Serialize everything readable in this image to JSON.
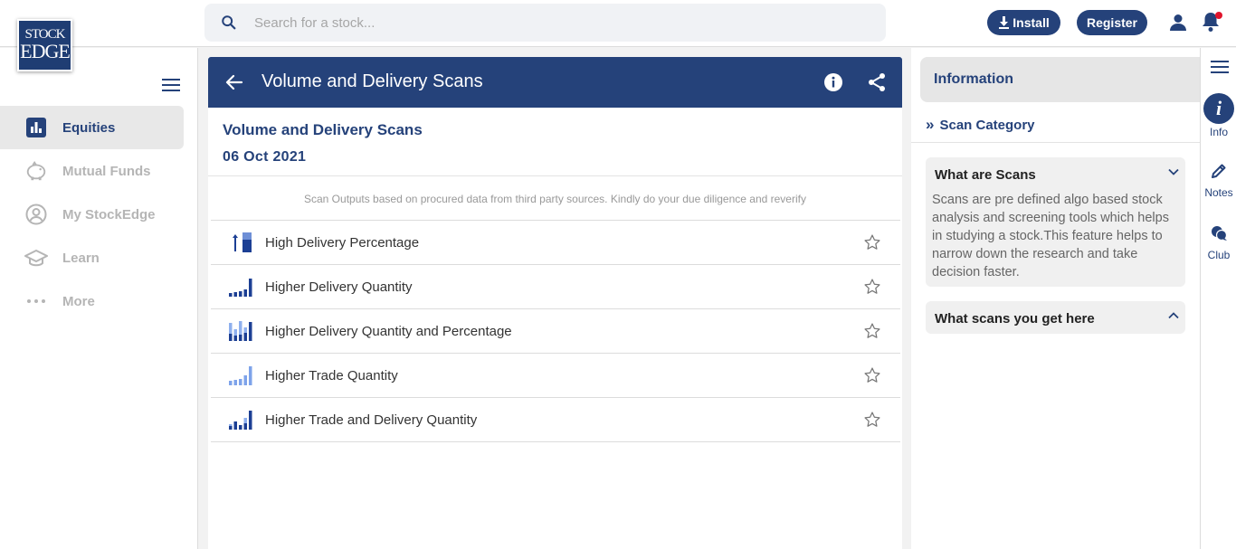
{
  "logo": {
    "line1": "STOCK",
    "line2": "EDGE"
  },
  "search": {
    "placeholder": "Search for a stock..."
  },
  "header": {
    "install_label": "Install",
    "register_label": "Register"
  },
  "sidebar": {
    "items": [
      {
        "label": "Equities",
        "icon": "bar-chart-icon",
        "active": true
      },
      {
        "label": "Mutual Funds",
        "icon": "piggy-bank-icon",
        "active": false
      },
      {
        "label": "My StockEdge",
        "icon": "user-circle-icon",
        "active": false
      },
      {
        "label": "Learn",
        "icon": "graduation-cap-icon",
        "active": false
      },
      {
        "label": "More",
        "icon": "more-dots-icon",
        "active": false
      }
    ]
  },
  "main": {
    "title": "Volume and Delivery Scans",
    "subtitle": "Volume and Delivery Scans",
    "date": "06 Oct 2021",
    "disclaimer": "Scan Outputs based on procured data from third party sources. Kindly do your due diligence and reverify",
    "scans": [
      {
        "label": "High Delivery Percentage",
        "icon": "high-delivery-icon"
      },
      {
        "label": "Higher Delivery Quantity",
        "icon": "delivery-quantity-icon"
      },
      {
        "label": "Higher Delivery Quantity and Percentage",
        "icon": "delivery-quantity-percentage-icon"
      },
      {
        "label": "Higher Trade Quantity",
        "icon": "trade-quantity-icon"
      },
      {
        "label": "Higher Trade and Delivery Quantity",
        "icon": "trade-delivery-quantity-icon"
      }
    ]
  },
  "info_panel": {
    "heading": "Information",
    "scan_category": "Scan Category",
    "what_are_scans_title": "What are Scans",
    "what_are_scans_body": "Scans are pre defined algo based stock analysis and screening tools which helps in studying a stock.This feature helps to narrow down the research and take decision faster.",
    "what_you_get_title": "What scans you get here"
  },
  "rail": {
    "items": [
      {
        "label": "Info"
      },
      {
        "label": "Notes"
      },
      {
        "label": "Club"
      }
    ]
  },
  "colors": {
    "brand": "#25427a",
    "notification_dot": "#e0142c",
    "inactive": "#b5b5b5"
  }
}
